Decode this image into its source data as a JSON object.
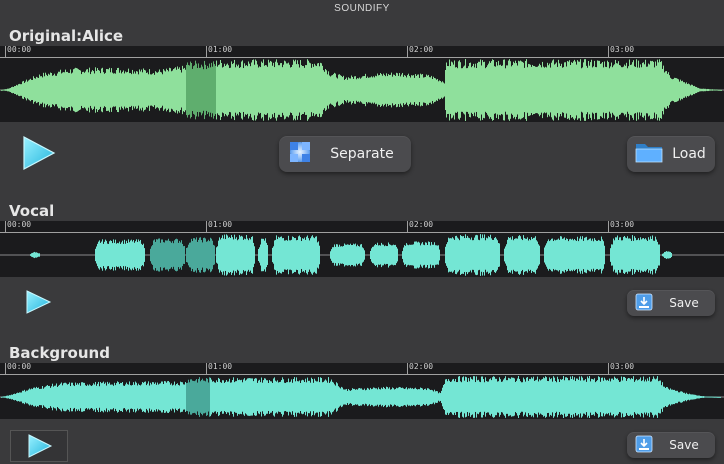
{
  "app": {
    "title": "SOUNDIFY"
  },
  "timeline": {
    "ticks": [
      "00:00",
      "01:00",
      "02:00",
      "03:00"
    ]
  },
  "colors": {
    "original_wave": "#8fe09c",
    "original_wave_dark": "#5fae6e",
    "vocal_wave": "#74e6d4",
    "vocal_wave_dark": "#4aa99b",
    "background_wave": "#74e6d4",
    "background_wave_dark": "#4aa99b",
    "play_icon": "#4fd6f0",
    "panel_bg": "#1b1b1d"
  },
  "original": {
    "title": "Original:Alice",
    "separate_label": "Separate",
    "load_label": "Load",
    "separate_icon": "separate-icon",
    "load_icon": "folder-icon"
  },
  "vocal": {
    "title": "Vocal",
    "save_label": "Save",
    "save_icon": "save-icon"
  },
  "background": {
    "title": "Background",
    "save_label": "Save",
    "save_icon": "save-icon"
  }
}
